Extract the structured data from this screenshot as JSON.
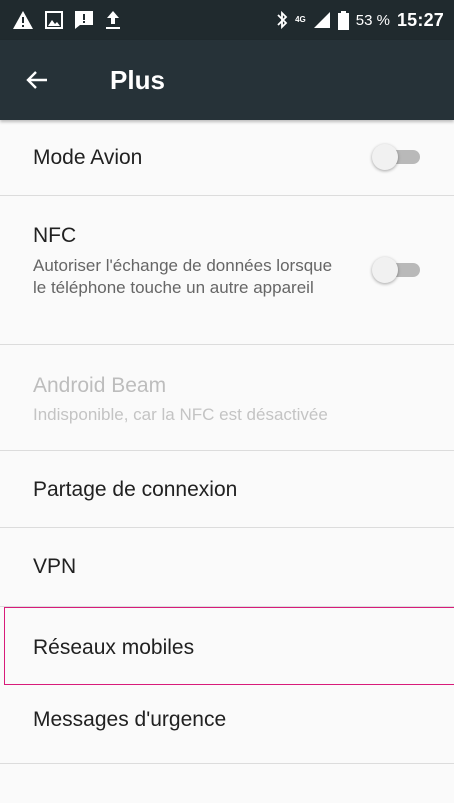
{
  "status_bar": {
    "network_type": "4G",
    "battery_percent": "53 %",
    "time": "15:27",
    "icons": [
      "warning-icon",
      "image-icon",
      "message-alert-icon",
      "upload-icon",
      "bluetooth-icon",
      "signal-icon",
      "battery-icon"
    ]
  },
  "app_bar": {
    "title": "Plus",
    "back_icon": "arrow-left-icon"
  },
  "settings": {
    "airplane_mode": {
      "title": "Mode Avion",
      "enabled": false
    },
    "nfc": {
      "title": "NFC",
      "subtitle": "Autoriser l'échange de données lorsque le téléphone touche un autre appareil",
      "enabled": false
    },
    "android_beam": {
      "title": "Android Beam",
      "subtitle": "Indisponible, car la NFC est désactivée"
    },
    "tethering": {
      "title": "Partage de connexion"
    },
    "vpn": {
      "title": "VPN"
    },
    "mobile_networks": {
      "title": "Réseaux mobiles"
    },
    "emergency_messages": {
      "title": "Messages d'urgence"
    }
  },
  "colors": {
    "status_bar": "#202a2e",
    "app_bar": "#263238",
    "background": "#fafafa",
    "divider": "#dcdcdc",
    "focus_outline": "#d81b7a",
    "switch_track_off": "#b9b9b9",
    "switch_thumb_off": "#f1f1f1"
  }
}
